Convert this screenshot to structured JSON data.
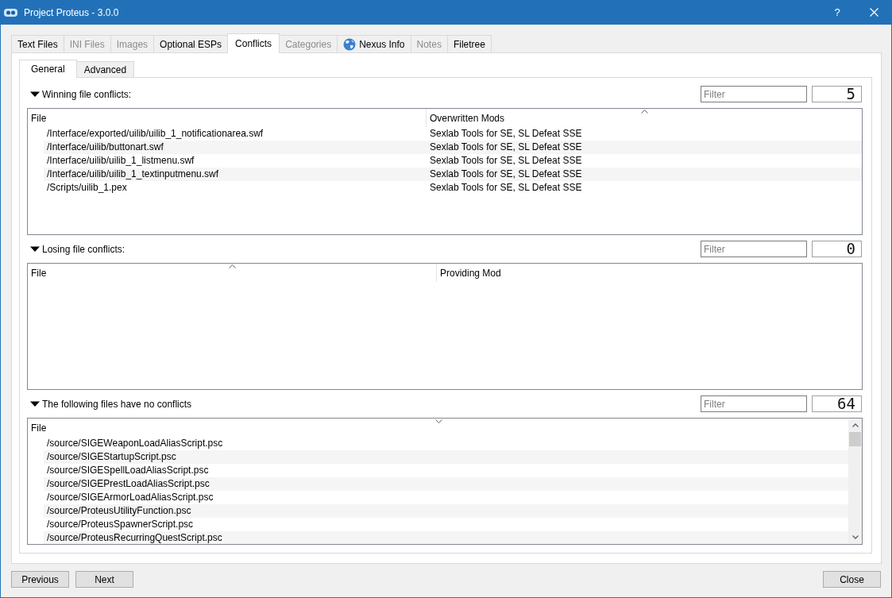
{
  "window": {
    "title": "Project Proteus - 3.0.0",
    "help_button": "?"
  },
  "tabs": [
    {
      "label": "Text Files",
      "kind": "text",
      "selected": false,
      "disabled": false
    },
    {
      "label": "INI Files",
      "kind": "text",
      "selected": false,
      "disabled": true
    },
    {
      "label": "Images",
      "kind": "text",
      "selected": false,
      "disabled": true
    },
    {
      "label": "Optional ESPs",
      "kind": "text",
      "selected": false,
      "disabled": false
    },
    {
      "label": "Conflicts",
      "kind": "text",
      "selected": true,
      "disabled": false
    },
    {
      "label": "Categories",
      "kind": "text",
      "selected": false,
      "disabled": true
    },
    {
      "label": "Nexus Info",
      "kind": "icon",
      "selected": false,
      "disabled": false
    },
    {
      "label": "Notes",
      "kind": "text",
      "selected": false,
      "disabled": true
    },
    {
      "label": "Filetree",
      "kind": "text",
      "selected": false,
      "disabled": false
    }
  ],
  "subtabs": [
    {
      "label": "General",
      "selected": true
    },
    {
      "label": "Advanced",
      "selected": false
    }
  ],
  "sections": [
    {
      "title": "Winning file conflicts:",
      "expanded": true,
      "filter": {
        "placeholder": "Filter"
      },
      "count": "5",
      "table": {
        "columns": [
          {
            "label": "File",
            "sorted": false
          },
          {
            "label": "Overwritten Mods",
            "sorted": true,
            "descending": false
          }
        ],
        "rows": [
          [
            "/Interface/exported/uilib/uilib_1_notificationarea.swf",
            "Sexlab Tools for SE, SL Defeat SSE"
          ],
          [
            "/Interface/uilib/buttonart.swf",
            "Sexlab Tools for SE, SL Defeat SSE"
          ],
          [
            "/Interface/uilib/uilib_1_listmenu.swf",
            "Sexlab Tools for SE, SL Defeat SSE"
          ],
          [
            "/Interface/uilib/uilib_1_textinputmenu.swf",
            "Sexlab Tools for SE, SL Defeat SSE"
          ],
          [
            "/Scripts/uilib_1.pex",
            "Sexlab Tools for SE, SL Defeat SSE"
          ]
        ]
      }
    },
    {
      "title": "Losing file conflicts:",
      "expanded": true,
      "filter": {
        "placeholder": "Filter"
      },
      "count": "0",
      "table": {
        "columns": [
          {
            "label": "File",
            "sorted": true,
            "descending": false
          },
          {
            "label": "Providing Mod",
            "sorted": false
          }
        ]
      }
    },
    {
      "title": "The following files have no conflicts",
      "expanded": true,
      "filter": {
        "placeholder": "Filter"
      },
      "count": "64",
      "table": {
        "columns": [
          {
            "label": "File",
            "sorted": true,
            "descending": true
          }
        ],
        "scrollbar": true,
        "rows": [
          [
            "/source/SIGEWeaponLoadAliasScript.psc"
          ],
          [
            "/source/SIGEStartupScript.psc"
          ],
          [
            "/source/SIGESpellLoadAliasScript.psc"
          ],
          [
            "/source/SIGEPrestLoadAliasScript.psc"
          ],
          [
            "/source/SIGEArmorLoadAliasScript.psc"
          ],
          [
            "/source/ProteusUtilityFunction.psc"
          ],
          [
            "/source/ProteusSpawnerScript.psc"
          ],
          [
            "/source/ProteusRecurringQuestScript.psc"
          ]
        ]
      }
    }
  ],
  "footer": {
    "nav_buttons": [
      "Previous",
      "Next"
    ],
    "close_button": "Close"
  }
}
